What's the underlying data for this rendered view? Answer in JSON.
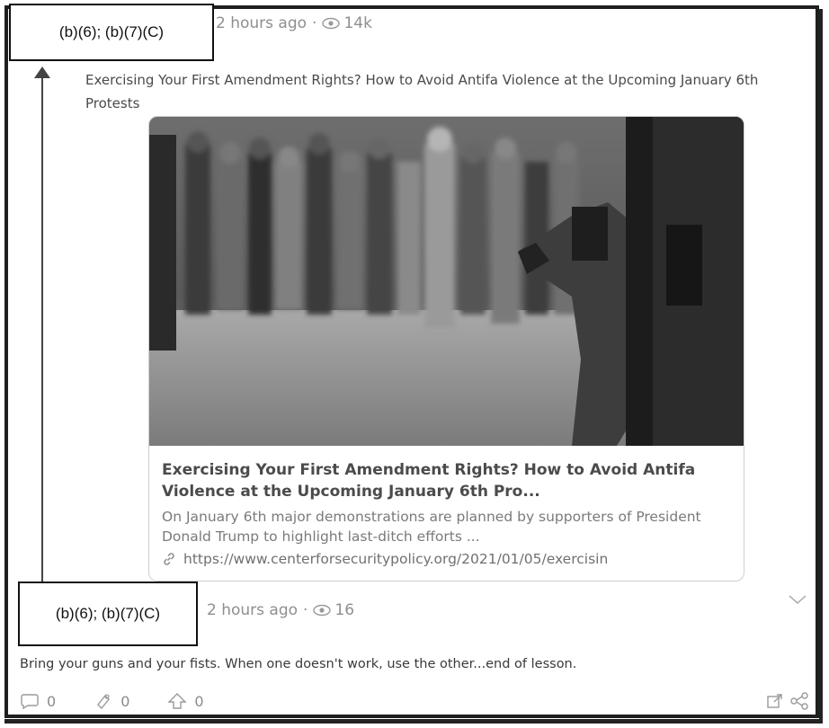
{
  "post": {
    "author_redacted": "(b)(6); (b)(7)(C)",
    "time": "2 hours ago",
    "separator": "·",
    "views": "14k",
    "text": "Exercising Your First Amendment Rights? How to Avoid Antifa Violence at the Upcoming January 6th Protests"
  },
  "link_card": {
    "title": "Exercising Your First Amendment Rights? How to Avoid Antifa Violence at the Upcoming January 6th Pro...",
    "description": "On January 6th major demonstrations are planned by supporters of President Donald Trump to highlight last-ditch efforts ...",
    "url": "https://www.centerforsecuritypolicy.org/2021/01/05/exercisin",
    "image_icon": "photo-crowd-and-police-dog"
  },
  "reply": {
    "author_redacted": "(b)(6); (b)(7)(C)",
    "time": "2 hours ago",
    "separator": "·",
    "views": "16",
    "text": "Bring your guns and your fists. When one doesn't work, use the other...end of lesson."
  },
  "actions": {
    "comments": "0",
    "reposts": "0",
    "upvotes": "0",
    "comment_icon": "comment-bubble-icon",
    "repost_icon": "repost-icon",
    "upvote_icon": "arrow-up-icon",
    "share_icon": "share-icon",
    "external_icon": "external-link-icon"
  },
  "colors": {
    "meta_text": "#8f8f8f",
    "thread_line": "#444444",
    "border": "#1f1f1f"
  }
}
